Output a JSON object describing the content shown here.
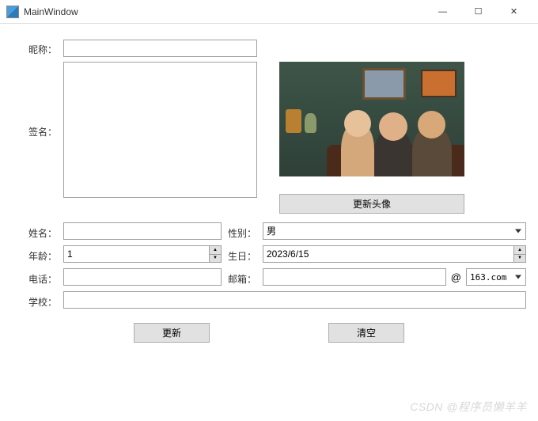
{
  "window": {
    "title": "MainWindow",
    "minimize": "—",
    "maximize": "☐",
    "close": "✕"
  },
  "form": {
    "nickname": {
      "label": "昵称：",
      "value": ""
    },
    "signature": {
      "label": "签名：",
      "value": ""
    },
    "avatar_button": "更新头像",
    "name": {
      "label": "姓名：",
      "value": ""
    },
    "gender": {
      "label": "性别：",
      "value": "男"
    },
    "age": {
      "label": "年龄：",
      "value": "1"
    },
    "birthday": {
      "label": "生日：",
      "value": "2023/6/15"
    },
    "phone": {
      "label": "电话：",
      "value": ""
    },
    "email": {
      "label": "邮箱：",
      "value": "",
      "at": "@",
      "domain": "163.com"
    },
    "school": {
      "label": "学校：",
      "value": ""
    }
  },
  "buttons": {
    "update": "更新",
    "clear": "清空"
  },
  "watermark": "CSDN @程序员懒羊羊"
}
